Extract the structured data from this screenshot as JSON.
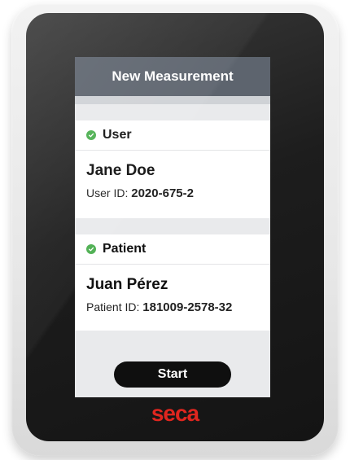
{
  "screen": {
    "title": "New Measurement",
    "user": {
      "section_label": "User",
      "name": "Jane Doe",
      "id_label": "User ID:",
      "id_value": "2020-675-2"
    },
    "patient": {
      "section_label": "Patient",
      "name": "Juan Pérez",
      "id_label": "Patient ID:",
      "id_value": "181009-2578-32"
    },
    "start_label": "Start"
  },
  "brand": {
    "logo_text": "seca",
    "logo_color": "#e0261f"
  },
  "icons": {
    "status": "check-circle-icon"
  },
  "colors": {
    "header_bg": "#5d646e",
    "status_ok": "#4caf50",
    "button_bg": "#0f0f0f"
  }
}
